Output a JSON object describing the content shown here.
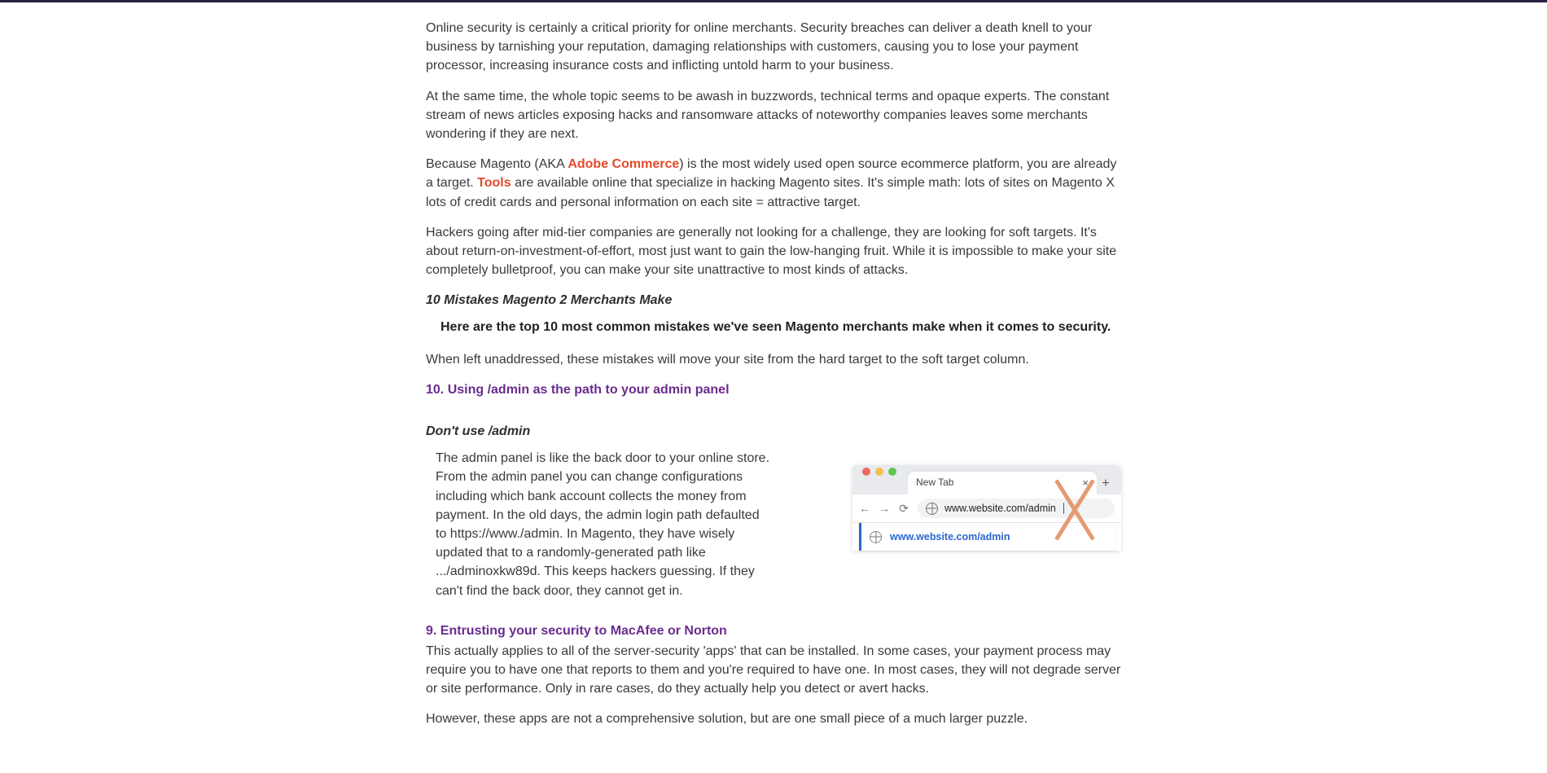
{
  "para1": "Online security is certainly a critical priority for online merchants. Security breaches can deliver a death knell to your business by tarnishing your reputation, damaging relationships with customers, causing you to lose your payment processor, increasing insurance costs and inflicting untold harm to your business.",
  "para2": "At the same time, the whole topic seems to be awash in buzzwords, technical terms and opaque experts. The constant stream of news articles exposing hacks and ransomware attacks of noteworthy companies leaves some merchants wondering if they are next.",
  "para3_a": "Because Magento (AKA ",
  "para3_link1": "Adobe Commerce",
  "para3_b": ") is the most widely used open source ecommerce platform, you are already a target. ",
  "para3_link2": "Tools",
  "para3_c": " are available online that specialize in hacking Magento sites. It's simple math: lots of sites on Magento X lots of credit cards and personal information on each site = attractive target.",
  "para4": "Hackers going after mid-tier companies are generally not looking for a challenge, they are looking for soft targets. It's about return-on-investment-of-effort, most just want to gain the low-hanging fruit. While it is impossible to make your site completely bulletproof, you can make your site unattractive to most kinds of attacks.",
  "mistakes_title": "10 Mistakes Magento 2 Merchants Make",
  "callout": "Here are the top 10 most common mistakes we've seen Magento merchants make when it comes to security.",
  "para5": "When left unaddressed, these mistakes will move your site from the hard target to the soft target column.",
  "h10": "10. Using /admin as the path to your admin panel",
  "dont_use": "Don't use /admin",
  "admin_text_a": "The admin panel is like the back door to your online store. From the admin panel you can change configurations including which bank account collects the money from payment. In the old days, the admin login path defaulted to ",
  "admin_url": "https://www./admin",
  "admin_text_b": ". In Magento, they have wisely updated that to a randomly-generated path like .../adminoxkw89d. This keeps hackers guessing. If they can't find the back door, they cannot get in.",
  "h9": "9. Entrusting your security to MacAfee or Norton",
  "para6": "This actually applies to all of the server-security 'apps' that can be installed. In some cases, your payment process may require you to have one that reports to them and you're required to have one. In most cases, they will not degrade server or site performance. Only in rare cases, do they actually help you detect or avert hacks.",
  "para7": "However, these apps are not a comprehensive solution, but are one small piece of a much larger puzzle.",
  "browser": {
    "tab_label": "New Tab",
    "typed_url": "www.website.com/admin",
    "suggest_url": "www.website.com/admin"
  }
}
